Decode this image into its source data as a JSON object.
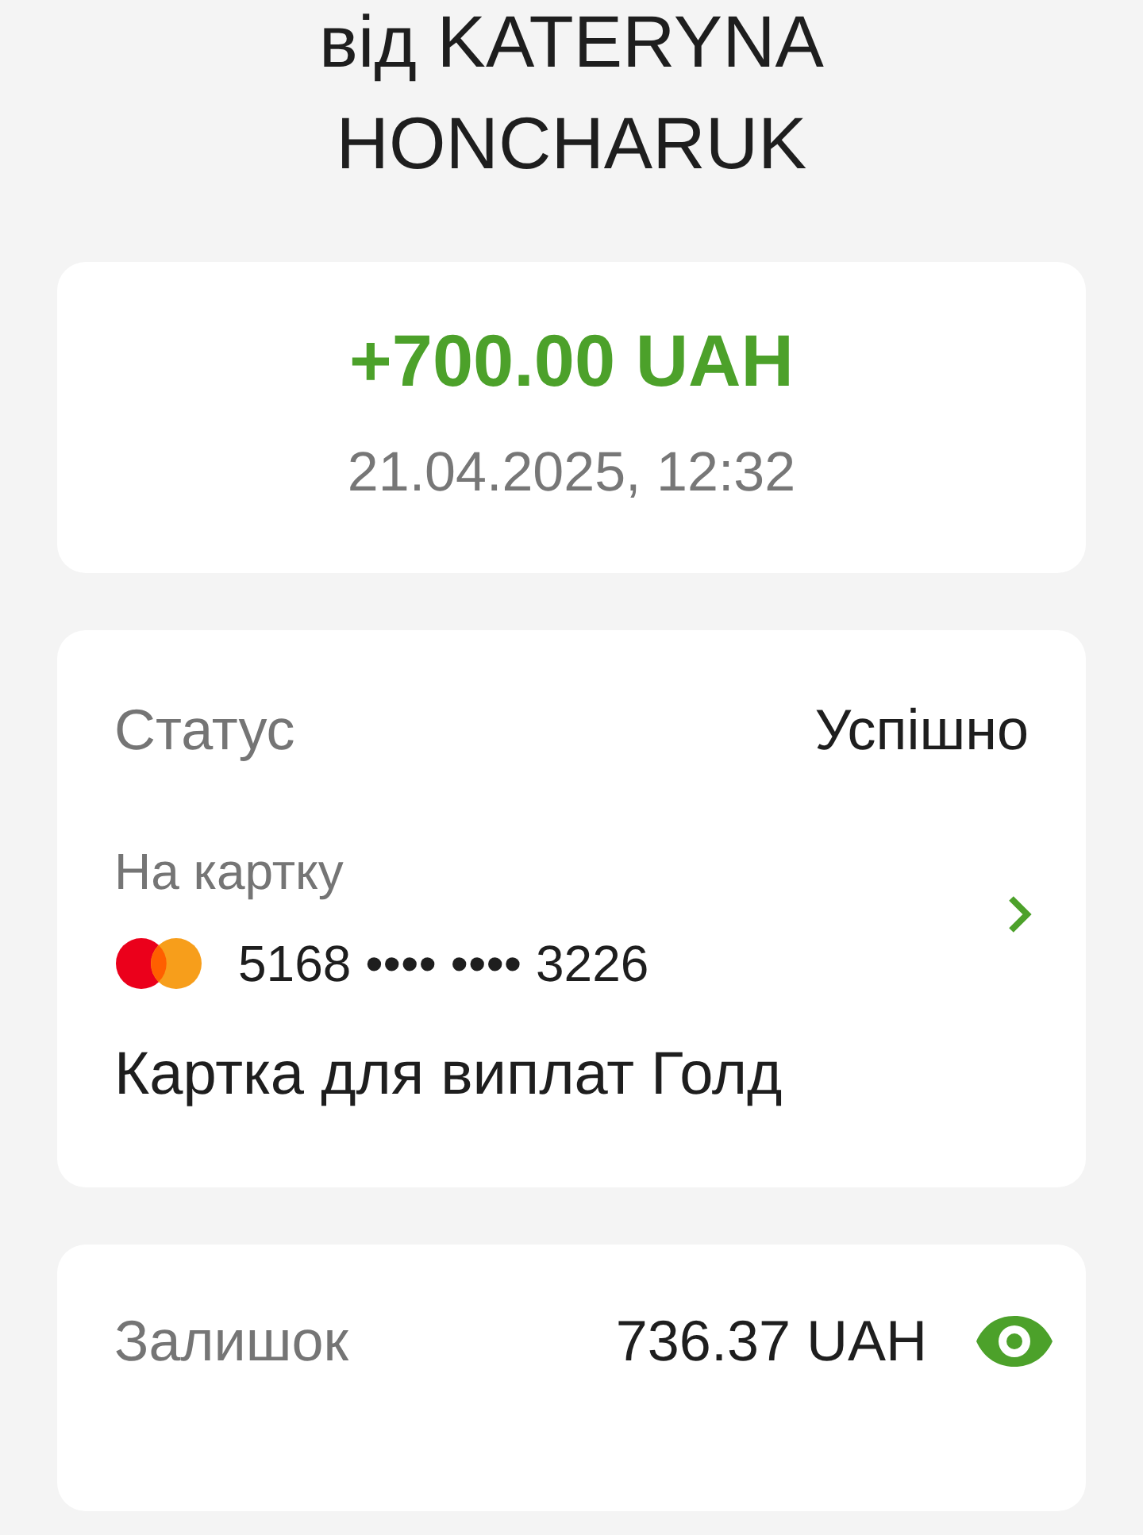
{
  "title": "від KATERYNA HONCHARUK",
  "summary": {
    "amount": "+700.00 UAH",
    "datetime": "21.04.2025, 12:32"
  },
  "details": {
    "status_label": "Статус",
    "status_value": "Успішно",
    "destination_label": "На картку",
    "card_number": "5168 •••• •••• 3226",
    "card_name": "Картка для виплат Голд"
  },
  "balance": {
    "label": "Залишок",
    "value": "736.37 UAH"
  }
}
